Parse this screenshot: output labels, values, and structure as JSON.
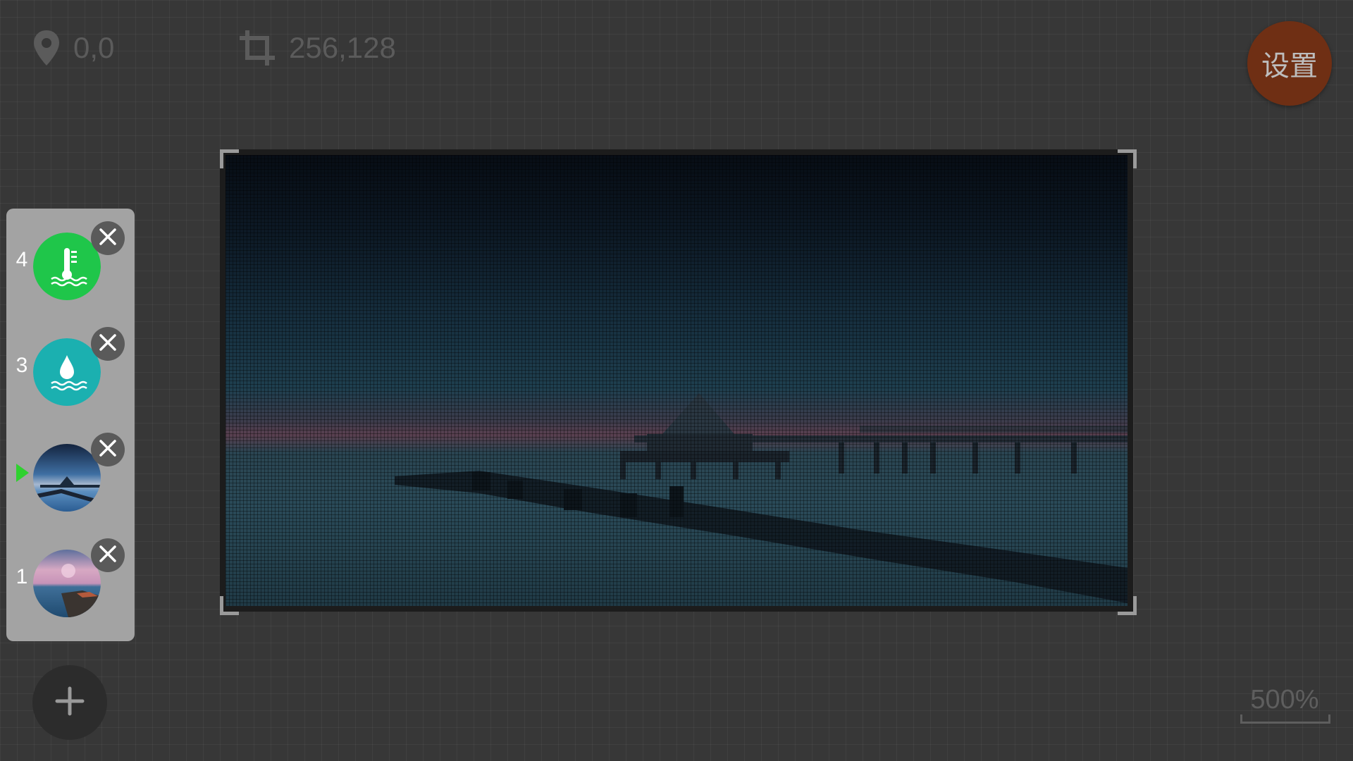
{
  "toolbar": {
    "position_icon": "map-pin-icon",
    "position_value": "0,0",
    "size_icon": "crop-icon",
    "size_value": "256,128",
    "settings_label": "设置",
    "settings_color": "#6f2f14"
  },
  "canvas": {
    "content": "photo of a pier and breakwater at dusk, pixelated"
  },
  "layers": {
    "items": [
      {
        "index": "4",
        "kind": "temperature",
        "icon": "water-temperature-icon",
        "color": "#1fc64a",
        "active": false
      },
      {
        "index": "3",
        "kind": "water-level",
        "icon": "water-drop-icon",
        "color": "#1bb0b0",
        "active": false
      },
      {
        "index": "",
        "kind": "image",
        "icon": "pier-photo-thumbnail",
        "active": true
      },
      {
        "index": "1",
        "kind": "image",
        "icon": "sunset-coast-photo-thumbnail",
        "active": false
      }
    ],
    "remove_icon": "close-icon",
    "active_marker_color": "#2fd12f"
  },
  "add_button": {
    "icon": "plus-icon"
  },
  "zoom": {
    "label": "500%"
  }
}
